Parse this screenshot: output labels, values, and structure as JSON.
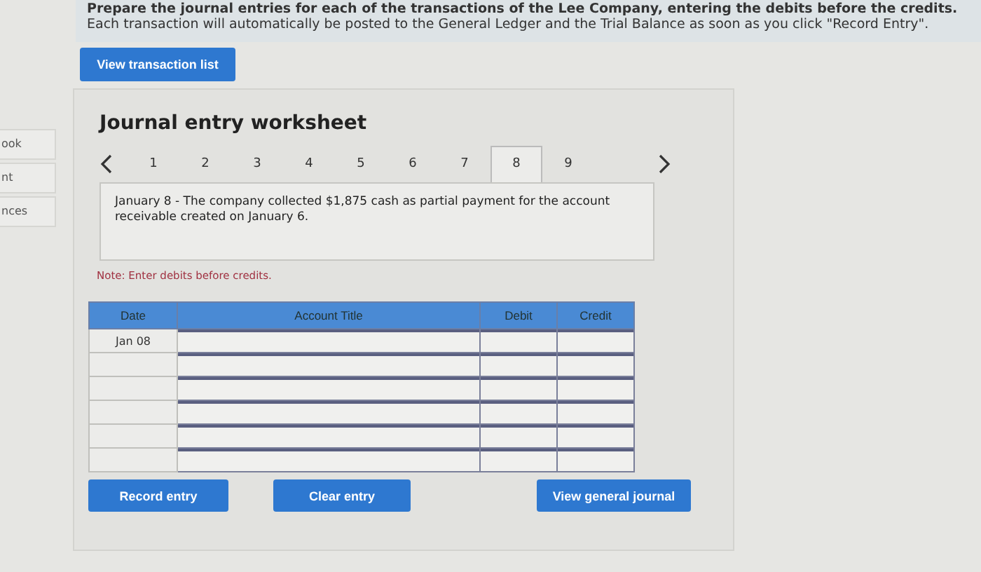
{
  "sidebar": {
    "items": [
      "ook",
      "nt",
      "nces"
    ]
  },
  "instructions": "**Prepare the journal entries for each of the transactions of the Lee Company, entering the debits before the credits.** Each transaction will automatically be posted to the General Ledger and the Trial Balance as soon as you click \"Record Entry\".",
  "view_transaction_button": "View transaction list",
  "worksheet": {
    "title": "Journal entry worksheet",
    "tabs": [
      {
        "label": "1",
        "selected": false
      },
      {
        "label": "2",
        "selected": false
      },
      {
        "label": "3",
        "selected": false
      },
      {
        "label": "4",
        "selected": false
      },
      {
        "label": "5",
        "selected": false
      },
      {
        "label": "6",
        "selected": false
      },
      {
        "label": "7",
        "selected": false
      },
      {
        "label": "8",
        "selected": true
      },
      {
        "label": "9",
        "selected": false
      }
    ],
    "description": "January 8 - The company collected $1,875 cash as partial payment for the account receivable created on January 6.",
    "note": "Note: Enter debits before credits.",
    "table": {
      "columns": [
        "Date",
        "Account Title",
        "Debit",
        "Credit"
      ],
      "rows": [
        {
          "date": "Jan 08"
        },
        {},
        {},
        {},
        {},
        {}
      ]
    },
    "buttons": [
      "Record entry",
      "Clear entry",
      "View general journal"
    ]
  }
}
